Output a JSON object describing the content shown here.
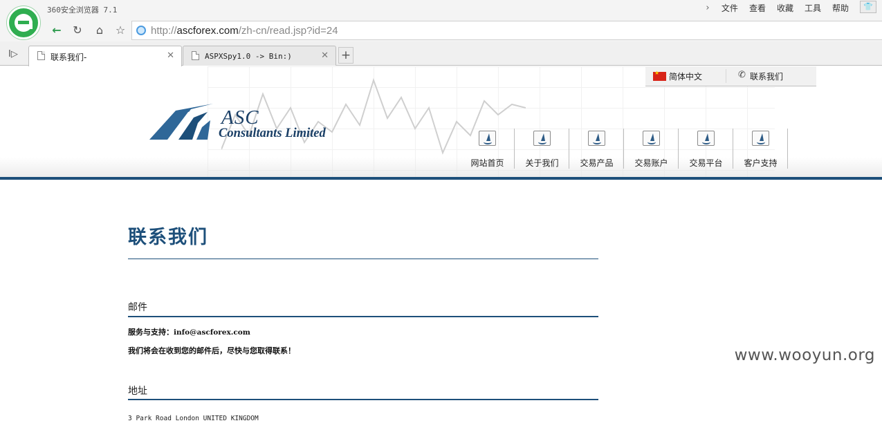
{
  "browser": {
    "title": "360安全浏览器 7.1",
    "menu": [
      "文件",
      "查看",
      "收藏",
      "工具",
      "帮助"
    ],
    "url_domain": "ascforex.com",
    "url_prefix": "http://",
    "url_path": "/zh-cn/read.jsp?id=24",
    "tabs": [
      {
        "label": "联系我们-",
        "active": true
      },
      {
        "label": "ASPXSpy1.0 -> Bin:)",
        "active": false
      }
    ]
  },
  "site": {
    "logo_main": "ASC",
    "logo_sub": "Consultants Limited",
    "lang_cn": "简体中文",
    "lang_contact": "联系我们",
    "nav": [
      "网站首页",
      "关于我们",
      "交易产品",
      "交易账户",
      "交易平台",
      "客户支持"
    ]
  },
  "content": {
    "title": "联系我们",
    "email_heading": "邮件",
    "email_label": "服务与支持：",
    "email_value": "info@ascforex.com",
    "email_note": "我们将会在收到您的邮件后，尽快与您取得联系！",
    "address_heading": "地址",
    "address": "3 Park Road London UNITED KINGDOM"
  },
  "watermark": "www.wooyun.org",
  "colors": {
    "brand_blue": "#1d4f7a",
    "browser_green": "#2fae50"
  }
}
